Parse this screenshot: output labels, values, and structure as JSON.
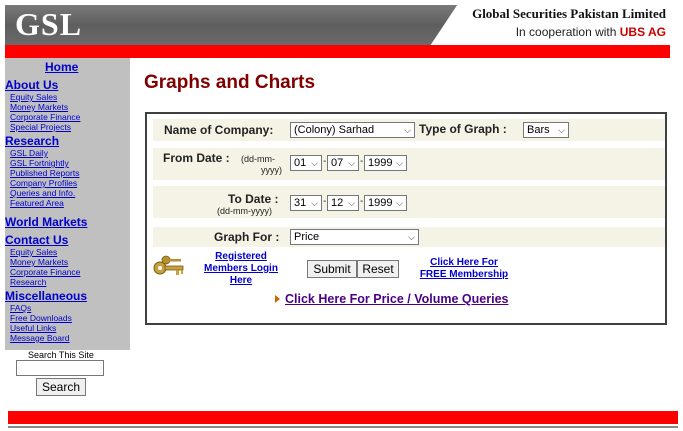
{
  "header": {
    "logo": "GSL",
    "company": "Global Securities Pakistan Limited",
    "cooperation_prefix": "In cooperation with ",
    "cooperation_partner": "UBS AG"
  },
  "sidebar": {
    "home": "Home",
    "sections": [
      {
        "title": "About Us",
        "items": [
          "Equity Sales",
          "Money Markets",
          "Corporate Finance",
          "Special Projects"
        ]
      },
      {
        "title": "Research",
        "items": [
          "GSL Daily",
          "GSL Fortnightly",
          "Published Reports",
          "Company Profiles",
          "Queries and Info.",
          "Featured Area"
        ]
      },
      {
        "title": "World Markets",
        "items": []
      },
      {
        "title": "Contact Us",
        "items": [
          "Equity Sales",
          "Money Markets",
          "Corporate Finance",
          "Research"
        ]
      },
      {
        "title": "Miscellaneous",
        "items": [
          "FAQs",
          "Free Downloads",
          "Useful Links",
          "Message Board"
        ]
      }
    ],
    "search_label": "Search This Site",
    "search_button": "Search"
  },
  "main": {
    "title": "Graphs and Charts",
    "form": {
      "company_label": "Name of Company:",
      "company_value": "(Colony) Sarhad",
      "graph_type_label": "Type of Graph :",
      "graph_type_value": "Bars",
      "from_label": "From Date :",
      "from_hint_1": "(dd-mm-",
      "from_hint_2": "yyyy)",
      "from_day": "01",
      "from_month": "07",
      "from_year": "1999",
      "to_label": "To Date :",
      "to_hint": "(dd-mm-yyyy)",
      "to_day": "31",
      "to_month": "12",
      "to_year": "1999",
      "graph_for_label": "Graph For :",
      "graph_for_value": "Price",
      "registered_link_1": "Registered",
      "registered_link_2": "Members Login",
      "registered_link_3": "Here",
      "submit": "Submit",
      "reset": "Reset",
      "free_link_1": "Click Here For",
      "free_link_2": "FREE Membership",
      "price_volume_link": "Click Here For Price / Volume Queries"
    }
  },
  "colors": {
    "red_bar": "#ff0000",
    "title": "#800000",
    "link": "#0000cc",
    "sidebar_bg": "#c0c0c0",
    "row_bg": "#f5f2e6"
  },
  "icons": [
    "key-icon",
    "arrow-icon",
    "chevron-down-icon"
  ]
}
